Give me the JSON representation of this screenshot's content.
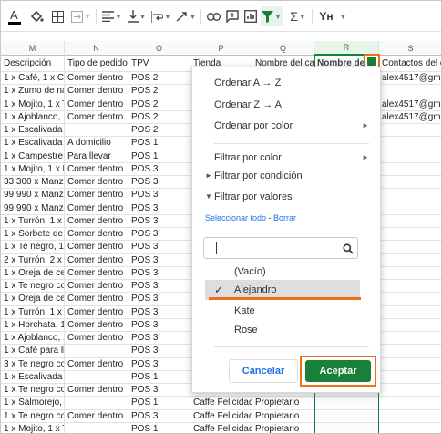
{
  "toolbar": {
    "items": [
      "text-color",
      "fill-color",
      "borders",
      "merge-cells",
      "horizontal-align",
      "vertical-align",
      "text-wrapping",
      "text-rotation",
      "insert-link",
      "insert-comment",
      "insert-chart",
      "create-filter",
      "functions",
      "input-tools"
    ],
    "sigma": "Σ",
    "input_tools_label": "Yн"
  },
  "columns": [
    {
      "letter": "M",
      "header": "Descripción"
    },
    {
      "letter": "N",
      "header": "Tipo de pedido"
    },
    {
      "letter": "O",
      "header": "TPV"
    },
    {
      "letter": "P",
      "header": "Tienda"
    },
    {
      "letter": "Q",
      "header": "Nombre del cajero"
    },
    {
      "letter": "R",
      "header": "Nombre del"
    },
    {
      "letter": "S",
      "header": "Contactos del cliente"
    }
  ],
  "rows": [
    {
      "m": "1 x Café, 1 x Caf",
      "n": "Comer dentro",
      "o": "POS 2",
      "s": "alex4517@gmail"
    },
    {
      "m": "1 x Zumo de nar",
      "n": "Comer dentro",
      "o": "POS 2",
      "s": ""
    },
    {
      "m": "1 x Mojito, 1 x Te",
      "n": "Comer dentro",
      "o": "POS 2",
      "s": "alex4517@gmail"
    },
    {
      "m": "1 x Ajoblanco, 1",
      "n": "Comer dentro",
      "o": "POS 2",
      "s": "alex4517@gmail"
    },
    {
      "m": "1 x Escalivada catalana, 1 x Ajobl",
      "n": "",
      "o": "POS 2",
      "s": ""
    },
    {
      "m": "1 x Escalivada c",
      "n": "A domicilio",
      "o": "POS 1",
      "s": ""
    },
    {
      "m": "1 x Campestre, 1",
      "n": "Para llevar",
      "o": "POS 1",
      "s": ""
    },
    {
      "m": "1 x Mojito, 1 x Es",
      "n": "Comer dentro",
      "o": "POS 3",
      "s": ""
    },
    {
      "m": "33.300 x Manzan",
      "n": "Comer dentro",
      "o": "POS 3",
      "s": ""
    },
    {
      "m": "99.990 x Manzan",
      "n": "Comer dentro",
      "o": "POS 3",
      "s": ""
    },
    {
      "m": "99.990 x Manzan",
      "n": "Comer dentro",
      "o": "POS 3",
      "s": ""
    },
    {
      "m": "1 x Turrón, 1 x C",
      "n": "Comer dentro",
      "o": "POS 3",
      "s": ""
    },
    {
      "m": "1 x Sorbete de s",
      "n": "Comer dentro",
      "o": "POS 3",
      "s": ""
    },
    {
      "m": "1 x Te negro, 1 x",
      "n": "Comer dentro",
      "o": "POS 3",
      "s": ""
    },
    {
      "m": "2 x Turrón, 2 x M",
      "n": "Comer dentro",
      "o": "POS 3",
      "s": ""
    },
    {
      "m": "1 x Oreja de cer",
      "n": "Comer dentro",
      "o": "POS 3",
      "s": ""
    },
    {
      "m": "1 x Te negro con",
      "n": "Comer dentro",
      "o": "POS 3",
      "s": ""
    },
    {
      "m": "1 x Oreja de cer",
      "n": "Comer dentro",
      "o": "POS 3",
      "s": ""
    },
    {
      "m": "1 x Turrón, 1 x M",
      "n": "Comer dentro",
      "o": "POS 3",
      "s": ""
    },
    {
      "m": "1 x Horchata, 1",
      "n": "Comer dentro",
      "o": "POS 3",
      "s": ""
    },
    {
      "m": "1 x Ajoblanco, 1",
      "n": "Comer dentro",
      "o": "POS 3",
      "s": ""
    },
    {
      "m": "1 x Café para llevar, 1 x Escalivad",
      "n": "",
      "o": "POS 3",
      "s": ""
    },
    {
      "m": "3 x Te negro con",
      "n": "Comer dentro",
      "o": "POS 3",
      "s": ""
    },
    {
      "m": "1 x Escalivada catalana, 1 x Capu",
      "n": "",
      "o": "POS 1",
      "s": ""
    },
    {
      "m": "1 x Te negro con",
      "n": "Comer dentro",
      "o": "POS 3",
      "s": ""
    },
    {
      "m": "1 x Salmorejo, 1 x Gazpacho, 1 x",
      "n": "",
      "o": "POS 1",
      "p": "Caffe Felicidad",
      "q": "Propietario",
      "s": ""
    },
    {
      "m": "1 x Te negro con",
      "n": "Comer dentro",
      "o": "POS 3",
      "p": "Caffe Felicidad",
      "q": "Propietario",
      "s": ""
    },
    {
      "m": "1 x Mojito, 1 x Te negro con limon",
      "n": "",
      "o": "POS 1",
      "p": "Caffe Felicidad",
      "q": "Propietario",
      "s": ""
    }
  ],
  "filter_menu": {
    "sort_az": "Ordenar A → Z",
    "sort_za": "Ordenar Z → A",
    "sort_color": "Ordenar por color",
    "filter_color": "Filtrar por color",
    "filter_condition": "Filtrar por condición",
    "filter_values": "Filtrar por valores",
    "select_all": "Seleccionar todo",
    "link_sep": " - ",
    "clear": "Borrar",
    "search_value": "",
    "options": [
      {
        "label": "(Vacío)",
        "checked": false
      },
      {
        "label": "Alejandro",
        "checked": true
      },
      {
        "label": "Kate",
        "checked": false
      },
      {
        "label": "Rose",
        "checked": false
      }
    ],
    "check_mark": "✓",
    "submenu_arrow": "►",
    "collapsed_arrow": "►",
    "expanded_arrow": "▼",
    "cancel": "Cancelar",
    "accept": "Aceptar"
  },
  "colors": {
    "accent_green": "#188038",
    "highlight_orange": "#e8711c",
    "link_blue": "#1a73e8"
  }
}
